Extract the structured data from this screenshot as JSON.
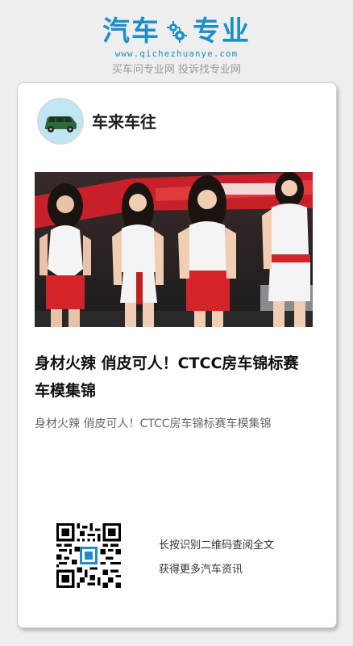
{
  "brand": {
    "name_part1": "汽车",
    "name_part2": "专业",
    "url": "www.qichezhuanye.com",
    "tagline": "买车问专业网 投诉找专业网"
  },
  "card": {
    "author_name": "车来车往",
    "article_title": "身材火辣 俏皮可人！CTCC房车锦标赛车模集锦",
    "article_summary": "身材火辣 俏皮可人！CTCC房车锦标赛车模集锦",
    "qr_hint_line1": "长按识别二维码查阅全文",
    "qr_hint_line2": "获得更多汽车资讯"
  },
  "colors": {
    "brand_blue": "#1e8fc6",
    "background": "#eeeeee",
    "card": "#ffffff"
  },
  "icons": {
    "brand_gear": "gear-icon",
    "avatar": "car-icon"
  }
}
